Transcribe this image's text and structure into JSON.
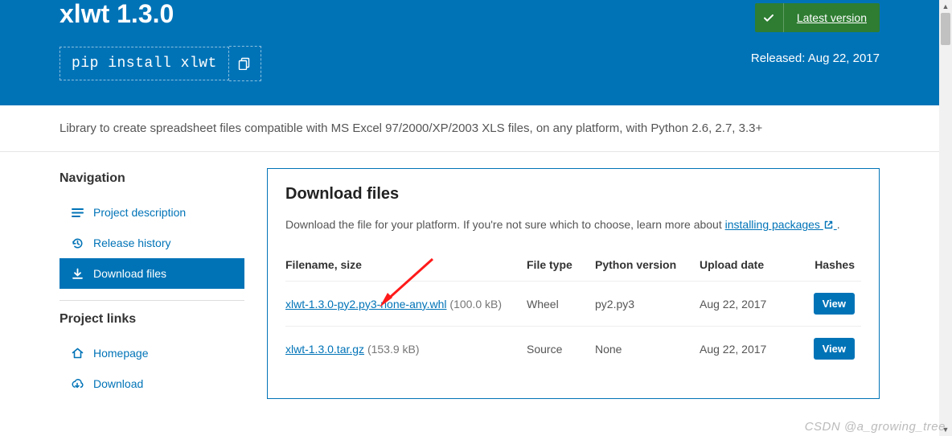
{
  "hero": {
    "title": "xlwt 1.3.0",
    "pip_cmd": "pip install xlwt",
    "latest_label": "Latest version",
    "released_prefix": "Released: ",
    "released_date": "Aug 22, 2017"
  },
  "summary": "Library to create spreadsheet files compatible with MS Excel 97/2000/XP/2003 XLS files, on any platform, with Python 2.6, 2.7, 3.3+",
  "sidebar": {
    "nav_heading": "Navigation",
    "items": [
      {
        "label": "Project description"
      },
      {
        "label": "Release history"
      },
      {
        "label": "Download files"
      }
    ],
    "links_heading": "Project links",
    "links": [
      {
        "label": "Homepage"
      },
      {
        "label": "Download"
      }
    ]
  },
  "main": {
    "heading": "Download files",
    "lead_pre": "Download the file for your platform. If you're not sure which to choose, learn more about ",
    "lead_link": "installing packages",
    "lead_post": ".",
    "columns": {
      "filename": "Filename, size",
      "filetype": "File type",
      "pyversion": "Python version",
      "upload": "Upload date",
      "hashes": "Hashes"
    },
    "rows": [
      {
        "filename": "xlwt-1.3.0-py2.py3-none-any.whl",
        "size": "(100.0 kB)",
        "filetype": "Wheel",
        "pyversion": "py2.py3",
        "upload": "Aug 22, 2017",
        "view": "View"
      },
      {
        "filename": "xlwt-1.3.0.tar.gz",
        "size": "(153.9 kB)",
        "filetype": "Source",
        "pyversion": "None",
        "upload": "Aug 22, 2017",
        "view": "View"
      }
    ]
  },
  "watermark": "CSDN @a_growing_tree"
}
